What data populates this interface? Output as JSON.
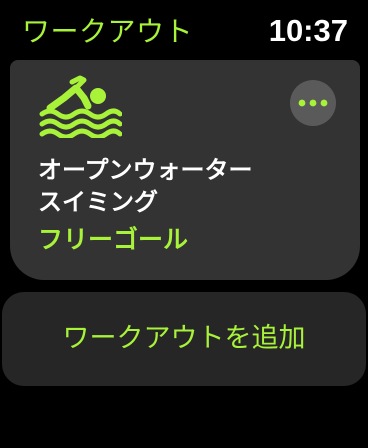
{
  "header": {
    "title": "ワークアウト",
    "time": "10:37"
  },
  "workout_card": {
    "icon": "open-water-swim-icon",
    "name_line1": "オープンウォーター",
    "name_line2": "スイミング",
    "goal": "フリーゴール",
    "more_icon": "more-ellipsis-icon"
  },
  "add_workout": {
    "label": "ワークアウトを追加"
  },
  "colors": {
    "accent": "#a8f23a",
    "card_background": "#333333",
    "button_background": "#262626",
    "more_button_background": "#5a5a5a"
  }
}
